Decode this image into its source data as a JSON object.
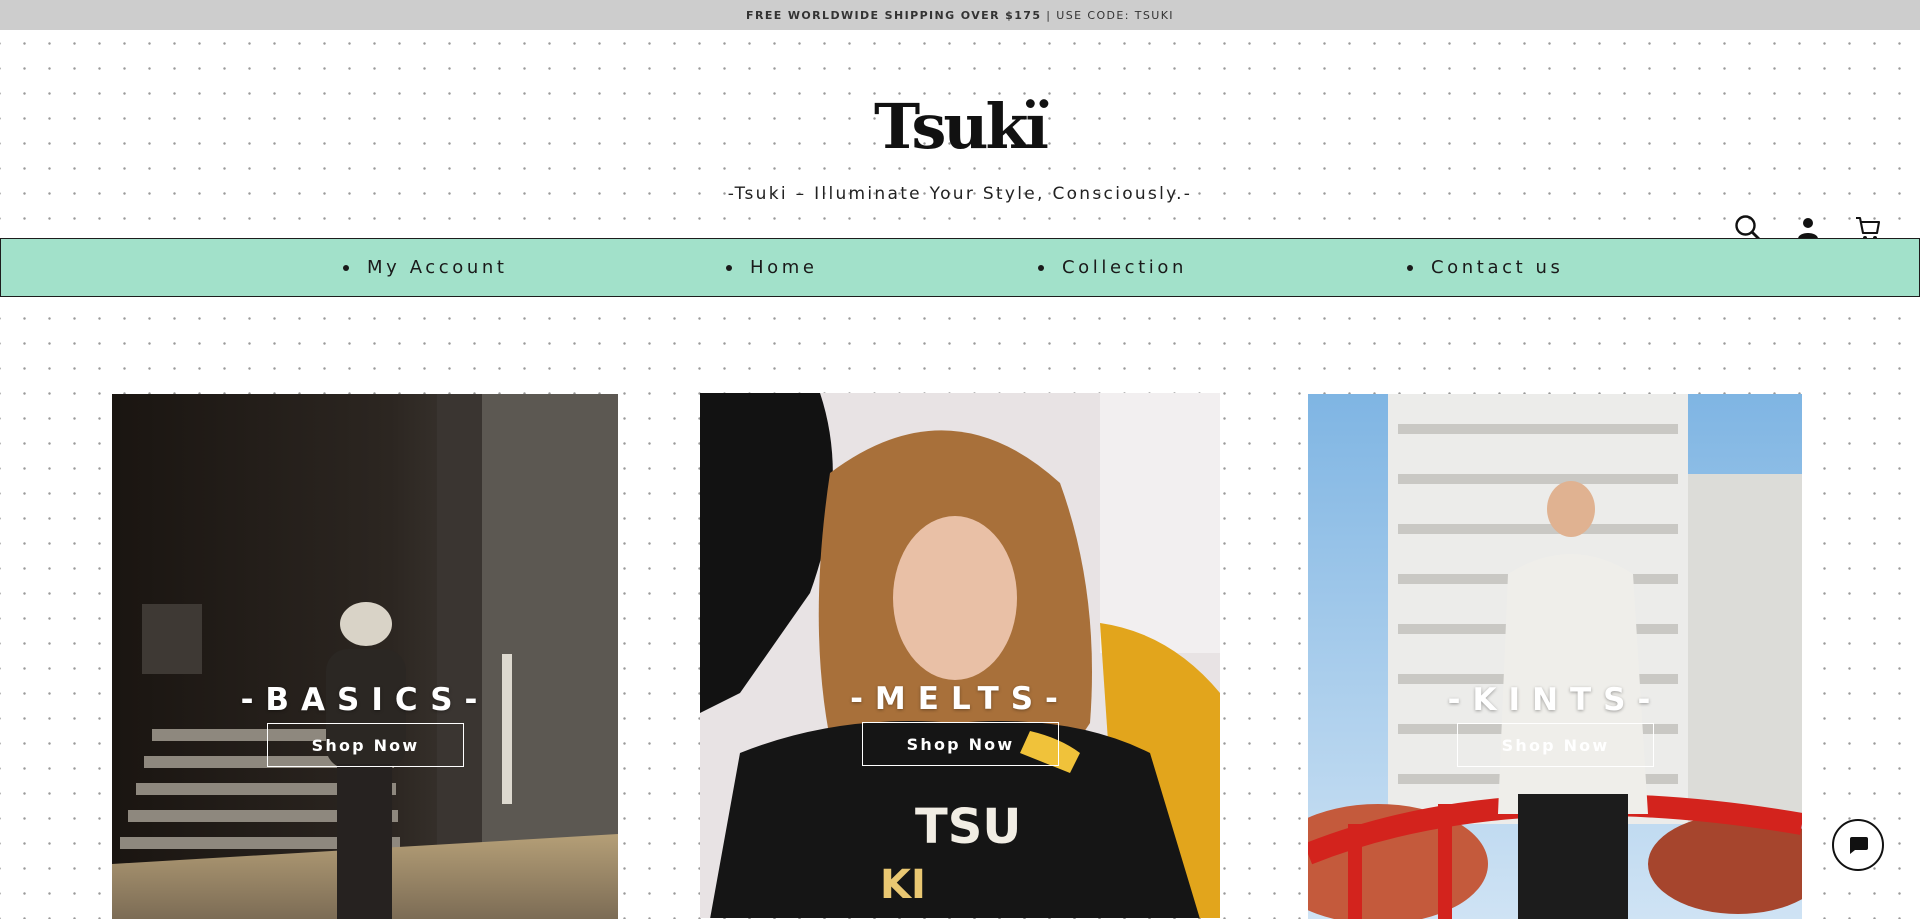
{
  "announcement": {
    "bold": "FREE WORLDWIDE SHIPPING OVER $175",
    "separator": " | ",
    "rest": "USE CODE: TSUKI"
  },
  "header": {
    "logo": "Tsukï",
    "tagline": "-Tsuki – Illuminate Your Style, Consciously.-"
  },
  "icons": {
    "search": "search-icon",
    "account": "account-icon",
    "cart": "cart-icon",
    "chat": "chat-icon"
  },
  "nav": {
    "items": [
      {
        "label": "My Account"
      },
      {
        "label": "Home"
      },
      {
        "label": "Collection"
      },
      {
        "label": "Contact us"
      }
    ]
  },
  "collections": [
    {
      "title": "-BASICS-",
      "button": "Shop Now"
    },
    {
      "title": "-MELTS-",
      "button": "Shop Now"
    },
    {
      "title": "-KINTS-",
      "button": "Shop Now"
    }
  ],
  "colors": {
    "nav_bg": "#a2e1ca",
    "announcement_bg": "#cdcdcd",
    "page_bg": "#ffffff"
  }
}
